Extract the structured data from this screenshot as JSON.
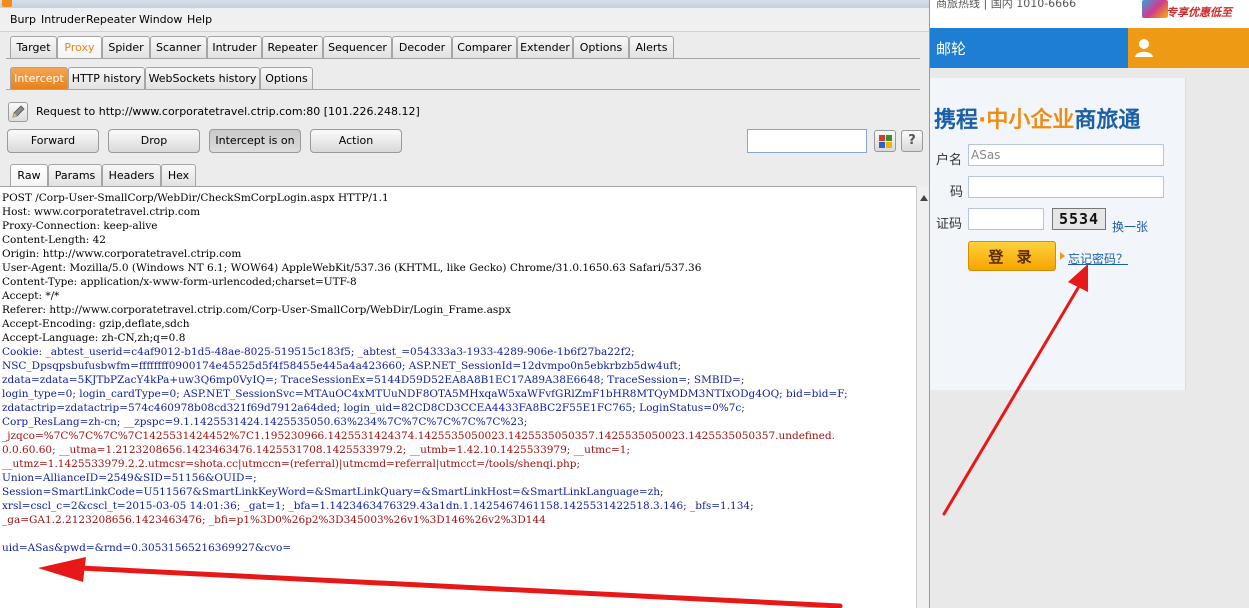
{
  "web": {
    "top_text": "商旅热线 | 国内 1010-6666",
    "promo_text": "专享优惠低至",
    "nav_item": "邮轮",
    "brand": {
      "part1": "携程",
      "dot": "·",
      "part2": "中小企业",
      "part3": "商旅通"
    },
    "username_label": "户名",
    "username_value": "ASas",
    "password_label": "码",
    "captcha_label": "证码",
    "captcha_code": "5534",
    "refresh_link": "换一张",
    "login_button": "登 录",
    "forgot_link": "忘记密码？",
    "colors": {
      "nav_blue": "#1e7ed3",
      "accent_orange": "#ef9a15"
    }
  },
  "burp": {
    "menu": [
      "Burp",
      "Intruder",
      "Repeater",
      "Window",
      "Help"
    ],
    "main_tabs": [
      "Target",
      "Proxy",
      "Spider",
      "Scanner",
      "Intruder",
      "Repeater",
      "Sequencer",
      "Decoder",
      "Comparer",
      "Extender",
      "Options",
      "Alerts"
    ],
    "active_main_tab": "Proxy",
    "sub_tabs": [
      "Intercept",
      "HTTP history",
      "WebSockets history",
      "Options"
    ],
    "active_sub_tab": "Intercept",
    "request_info": "Request to http://www.corporatetravel.ctrip.com:80  [101.226.248.12]",
    "buttons": {
      "forward": "Forward",
      "drop": "Drop",
      "intercept": "Intercept is on",
      "action": "Action"
    },
    "help_icon": "?",
    "view_tabs": [
      "Raw",
      "Params",
      "Headers",
      "Hex"
    ],
    "active_view_tab": "Raw",
    "request_lines": [
      "POST /Corp-User-SmallCorp/WebDir/CheckSmCorpLogin.aspx HTTP/1.1",
      "Host: www.corporatetravel.ctrip.com",
      "Proxy-Connection: keep-alive",
      "Content-Length: 42",
      "Origin: http://www.corporatetravel.ctrip.com",
      "User-Agent: Mozilla/5.0 (Windows NT 6.1; WOW64) AppleWebKit/537.36 (KHTML, like Gecko) Chrome/31.0.1650.63 Safari/537.36",
      "Content-Type: application/x-www-form-urlencoded;charset=UTF-8",
      "Accept: */*",
      "Referer: http://www.corporatetravel.ctrip.com/Corp-User-SmallCorp/WebDir/Login_Frame.aspx",
      "Accept-Encoding: gzip,deflate,sdch",
      "Accept-Language: zh-CN,zh;q=0.8"
    ],
    "cookie_lines": [
      "Cookie: _abtest_userid=c4af9012-b1d5-48ae-8025-519515c183f5; _abtest_=054333a3-1933-4289-906e-1b6f27ba22f2;",
      "NSC_Dpsqpsbufusbwfm=ffffffff0900174e45525d5f4f58455e445a4a423660; ASP.NET_SessionId=12dvmpo0n5ebkrbzb5dw4uft;",
      "zdata=zdata=5KJTbPZacY4kPa+uw3Q6mp0VyIQ=; TraceSessionEx=5144D59D52EA8A8B1EC17A89A38E6648; TraceSession=; SMBID=;",
      "login_type=0; login_cardType=0; ASP.NET_SessionSvc=MTAuOC4xMTUuNDF8OTA5MHxqaW5xaWFvfGRlZmF1bHR8MTQyMDM3NTIxODg4OQ; bid=bid=F;",
      "zdatactrip=zdatactrip=574c460978b08cd321f69d7912a64ded; login_uid=82CD8CD3CCEA4433FA8BC2F55E1FC765; LoginStatus=0%7c;",
      "Corp_ResLang=zh-cn; __zpspc=9.1.1425531424.1425535050.63%234%7C%7C%7C%7C%7C%23;",
      "_jzqco=%7C%7C%7C%7C1425531424452%7C1.195230966.1425531424374.1425535050023.1425535050357.1425535050023.1425535050357.undefined.",
      "0.0.60.60; __utma=1.2123208656.1423463476.1425531708.1425533979.2; __utmb=1.42.10.1425533979; __utmc=1;",
      "__utmz=1.1425533979.2.2.utmcsr=shota.cc|utmccn=(referral)|utmcmd=referral|utmcct=/tools/shenqi.php;",
      "Union=AllianceID=2549&SID=51156&OUID=;",
      "Session=SmartLinkCode=U511567&SmartLinkKeyWord=&SmartLinkQuary=&SmartLinkHost=&SmartLinkLanguage=zh;",
      "xrsl=cscl_c=2&cscl_t=2015-03-05 14:01:36; _gat=1; _bfa=1.1423463476329.43a1dn.1.1425467461158.1425531422518.3.146; _bfs=1.134;",
      "_ga=GA1.2.2123208656.1423463476; _bfi=p1%3D0%26p2%3D345003%26v1%3D146%26v2%3D144"
    ],
    "body_line": "uid=ASas&pwd=&rnd=0.30531565216369927&cvo=",
    "colors": {
      "cookie_name": "#1020a0",
      "cookie_value": "#a01010",
      "proxy_orange": "#e8821b",
      "annotation_red": "#e81818"
    }
  }
}
